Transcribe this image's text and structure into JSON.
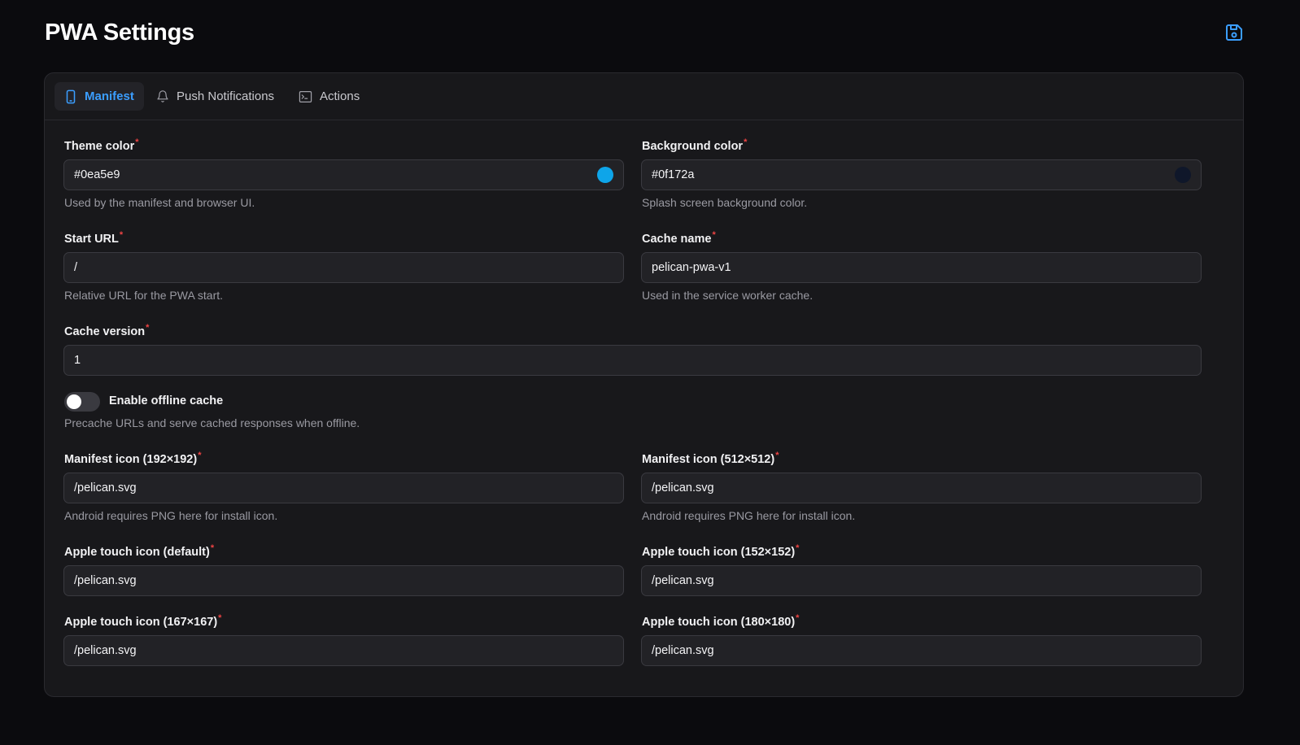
{
  "header": {
    "title": "PWA Settings",
    "save_icon": "save-icon"
  },
  "tabs": [
    {
      "label": "Manifest",
      "icon": "smartphone-icon",
      "active": true
    },
    {
      "label": "Push Notifications",
      "icon": "bell-icon",
      "active": false
    },
    {
      "label": "Actions",
      "icon": "terminal-icon",
      "active": false
    }
  ],
  "form": {
    "theme_color": {
      "label": "Theme color",
      "required": "*",
      "value": "#0ea5e9",
      "swatch": "#0ea5e9",
      "hint": "Used by the manifest and browser UI."
    },
    "background_color": {
      "label": "Background color",
      "required": "*",
      "value": "#0f172a",
      "swatch": "#0f172a",
      "hint": "Splash screen background color."
    },
    "start_url": {
      "label": "Start URL",
      "required": "*",
      "value": "/",
      "hint": "Relative URL for the PWA start."
    },
    "cache_name": {
      "label": "Cache name",
      "required": "*",
      "value": "pelican-pwa-v1",
      "hint": "Used in the service worker cache."
    },
    "cache_version": {
      "label": "Cache version",
      "required": "*",
      "value": "1"
    },
    "offline_cache": {
      "label": "Enable offline cache",
      "enabled": false,
      "hint": "Precache URLs and serve cached responses when offline."
    },
    "manifest_icon_192": {
      "label": "Manifest icon (192×192)",
      "required": "*",
      "value": "/pelican.svg",
      "hint": "Android requires PNG here for install icon."
    },
    "manifest_icon_512": {
      "label": "Manifest icon (512×512)",
      "required": "*",
      "value": "/pelican.svg",
      "hint": "Android requires PNG here for install icon."
    },
    "apple_icon_default": {
      "label": "Apple touch icon (default)",
      "required": "*",
      "value": "/pelican.svg"
    },
    "apple_icon_152": {
      "label": "Apple touch icon (152×152)",
      "required": "*",
      "value": "/pelican.svg"
    },
    "apple_icon_167": {
      "label": "Apple touch icon (167×167)",
      "required": "*",
      "value": "/pelican.svg"
    },
    "apple_icon_180": {
      "label": "Apple touch icon (180×180)",
      "required": "*",
      "value": "/pelican.svg"
    }
  },
  "colors": {
    "accent": "#3b9eff",
    "required": "#ef4444",
    "background": "#0b0b0e",
    "card": "#18181b"
  }
}
